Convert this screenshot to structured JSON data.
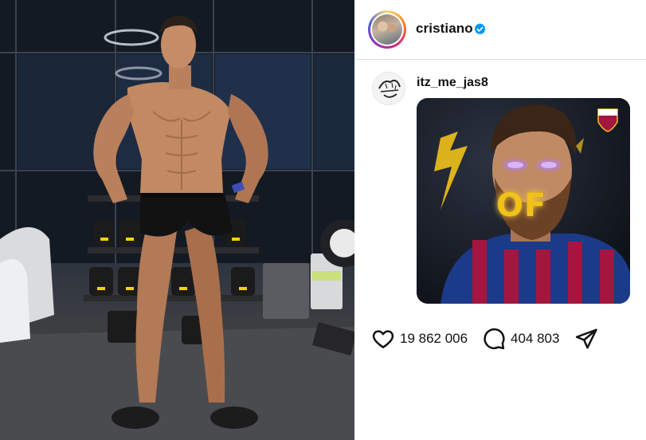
{
  "post": {
    "author": {
      "username": "cristiano",
      "verified": true,
      "avatar_icon": "profile-photo",
      "ring_colors": [
        "#feda75",
        "#fa7e1e",
        "#d62976",
        "#962fbf",
        "#4f5bd5"
      ]
    },
    "photo": {
      "description_icon": "athlete-photo"
    }
  },
  "comment": {
    "username": "itz_me_jas8",
    "avatar_icon": "sketch-avatar",
    "gif": {
      "overlay_text": "OF",
      "badge_icon": "club-crest"
    }
  },
  "actions": {
    "likes": "19 862 006",
    "comments": "404 803",
    "like_icon": "heart-icon",
    "comment_icon": "speech-bubble-icon",
    "share_icon": "paper-plane-icon"
  },
  "colors": {
    "verified_blue": "#0095f6",
    "divider": "#dbdbdb",
    "gif_gold": "#f2c21b"
  }
}
